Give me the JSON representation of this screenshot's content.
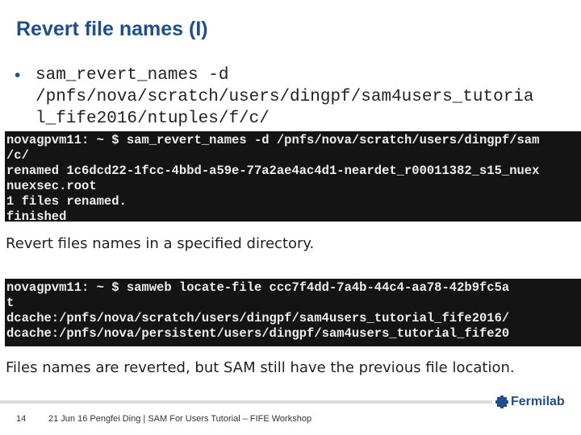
{
  "slide": {
    "title": "Revert file names (I)",
    "bullet_command": [
      "sam_revert_names -d",
      "/pnfs/nova/scratch/users/dingpf/sam4users_tutoria",
      "l_fife2016/ntuples/f/c/"
    ],
    "terminal1": [
      "novagpvm11: ~ $ sam_revert_names -d /pnfs/nova/scratch/users/dingpf/sam",
      "/c/",
      "renamed 1c6dcd22-1fcc-4bbd-a59e-77a2ae4ac4d1-neardet_r00011382_s15_nuex",
      "nuexsec.root",
      "1 files renamed.",
      "finished"
    ],
    "caption1": "Revert files names in a specified directory.",
    "terminal2": [
      "novagpvm11: ~ $ samweb locate-file ccc7f4dd-7a4b-44c4-aa78-42b9fc5a",
      "t",
      "dcache:/pnfs/nova/scratch/users/dingpf/sam4users_tutorial_fife2016/",
      "dcache:/pnfs/nova/persistent/users/dingpf/sam4users_tutorial_fife20"
    ],
    "caption2": "Files names are reverted, but SAM still have the previous file location."
  },
  "footer": {
    "page_number": "14",
    "text": "21 Jun 16   Pengfei Ding | SAM For Users Tutorial – FIFE Workshop",
    "logo_text": "Fermilab",
    "logo_icon": "fermilab-logo-icon"
  },
  "colors": {
    "title": "#1f4e8c",
    "terminal_bg": "#141414",
    "terminal_fg": "#eeeeee"
  }
}
